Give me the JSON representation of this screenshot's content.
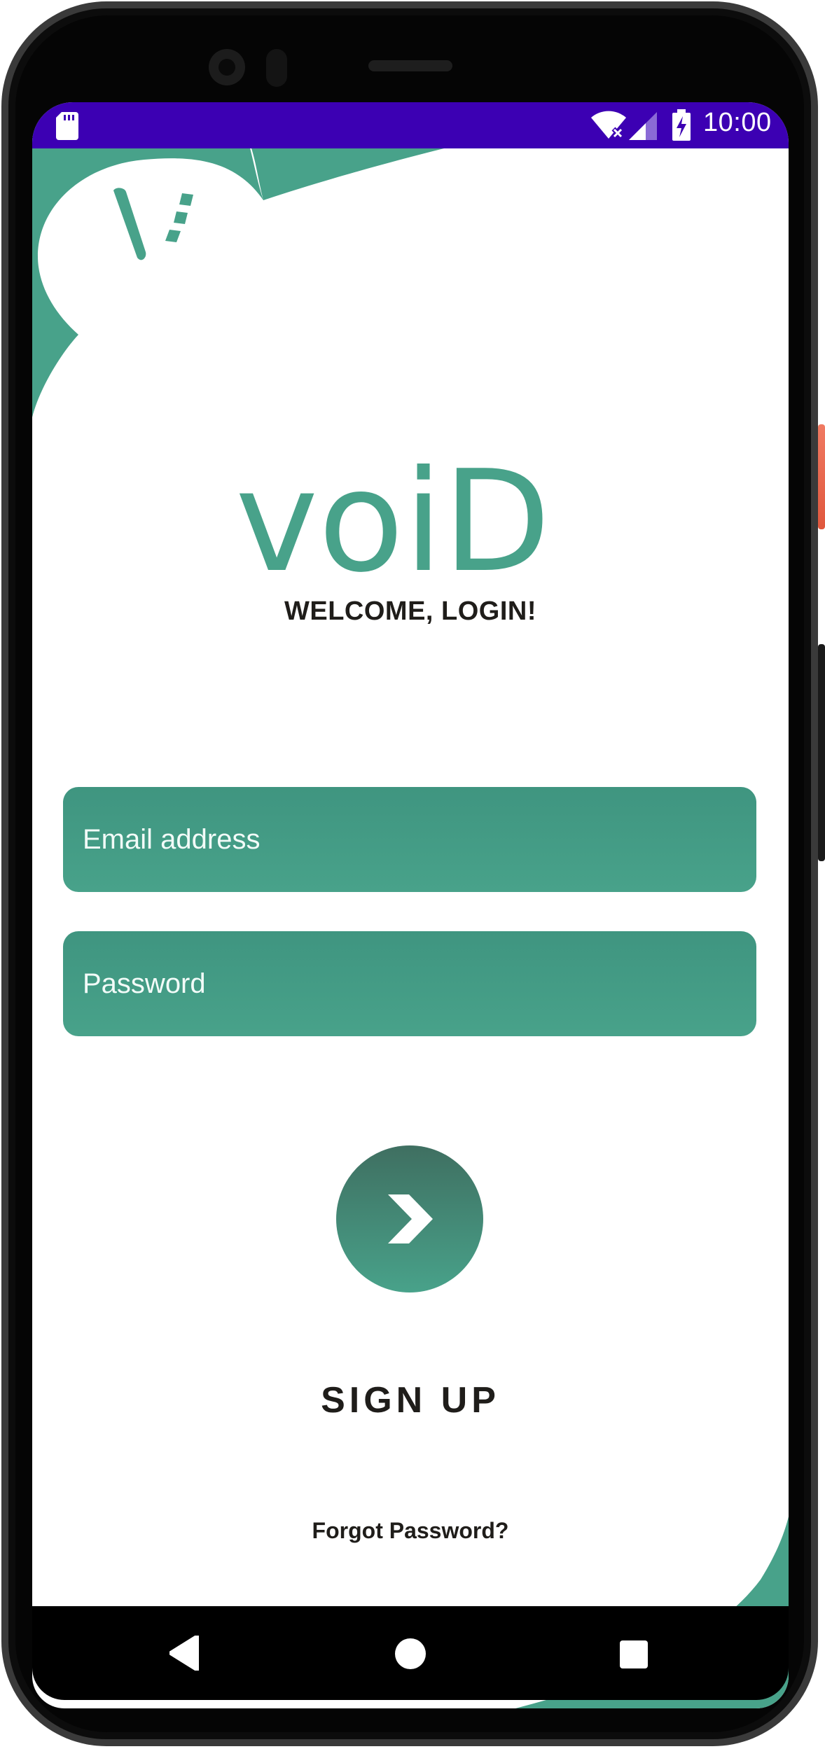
{
  "status_bar": {
    "time": "10:00",
    "background_color": "#3c00b3",
    "icons": [
      "sd-card-icon",
      "wifi-icon",
      "signal-icon",
      "battery-charging-icon"
    ]
  },
  "brand": {
    "wordmark": "voiD",
    "corner_logo": "V",
    "accent_color": "#48a28a"
  },
  "login": {
    "welcome": "WELCOME, LOGIN!",
    "email_placeholder": "Email address",
    "password_placeholder": "Password",
    "submit_icon": "chevron-right-icon",
    "signup_label": "SIGN UP",
    "forgot_label": "Forgot Password?"
  },
  "nav_bar": {
    "icons": [
      "back-icon",
      "home-icon",
      "recents-icon"
    ]
  }
}
